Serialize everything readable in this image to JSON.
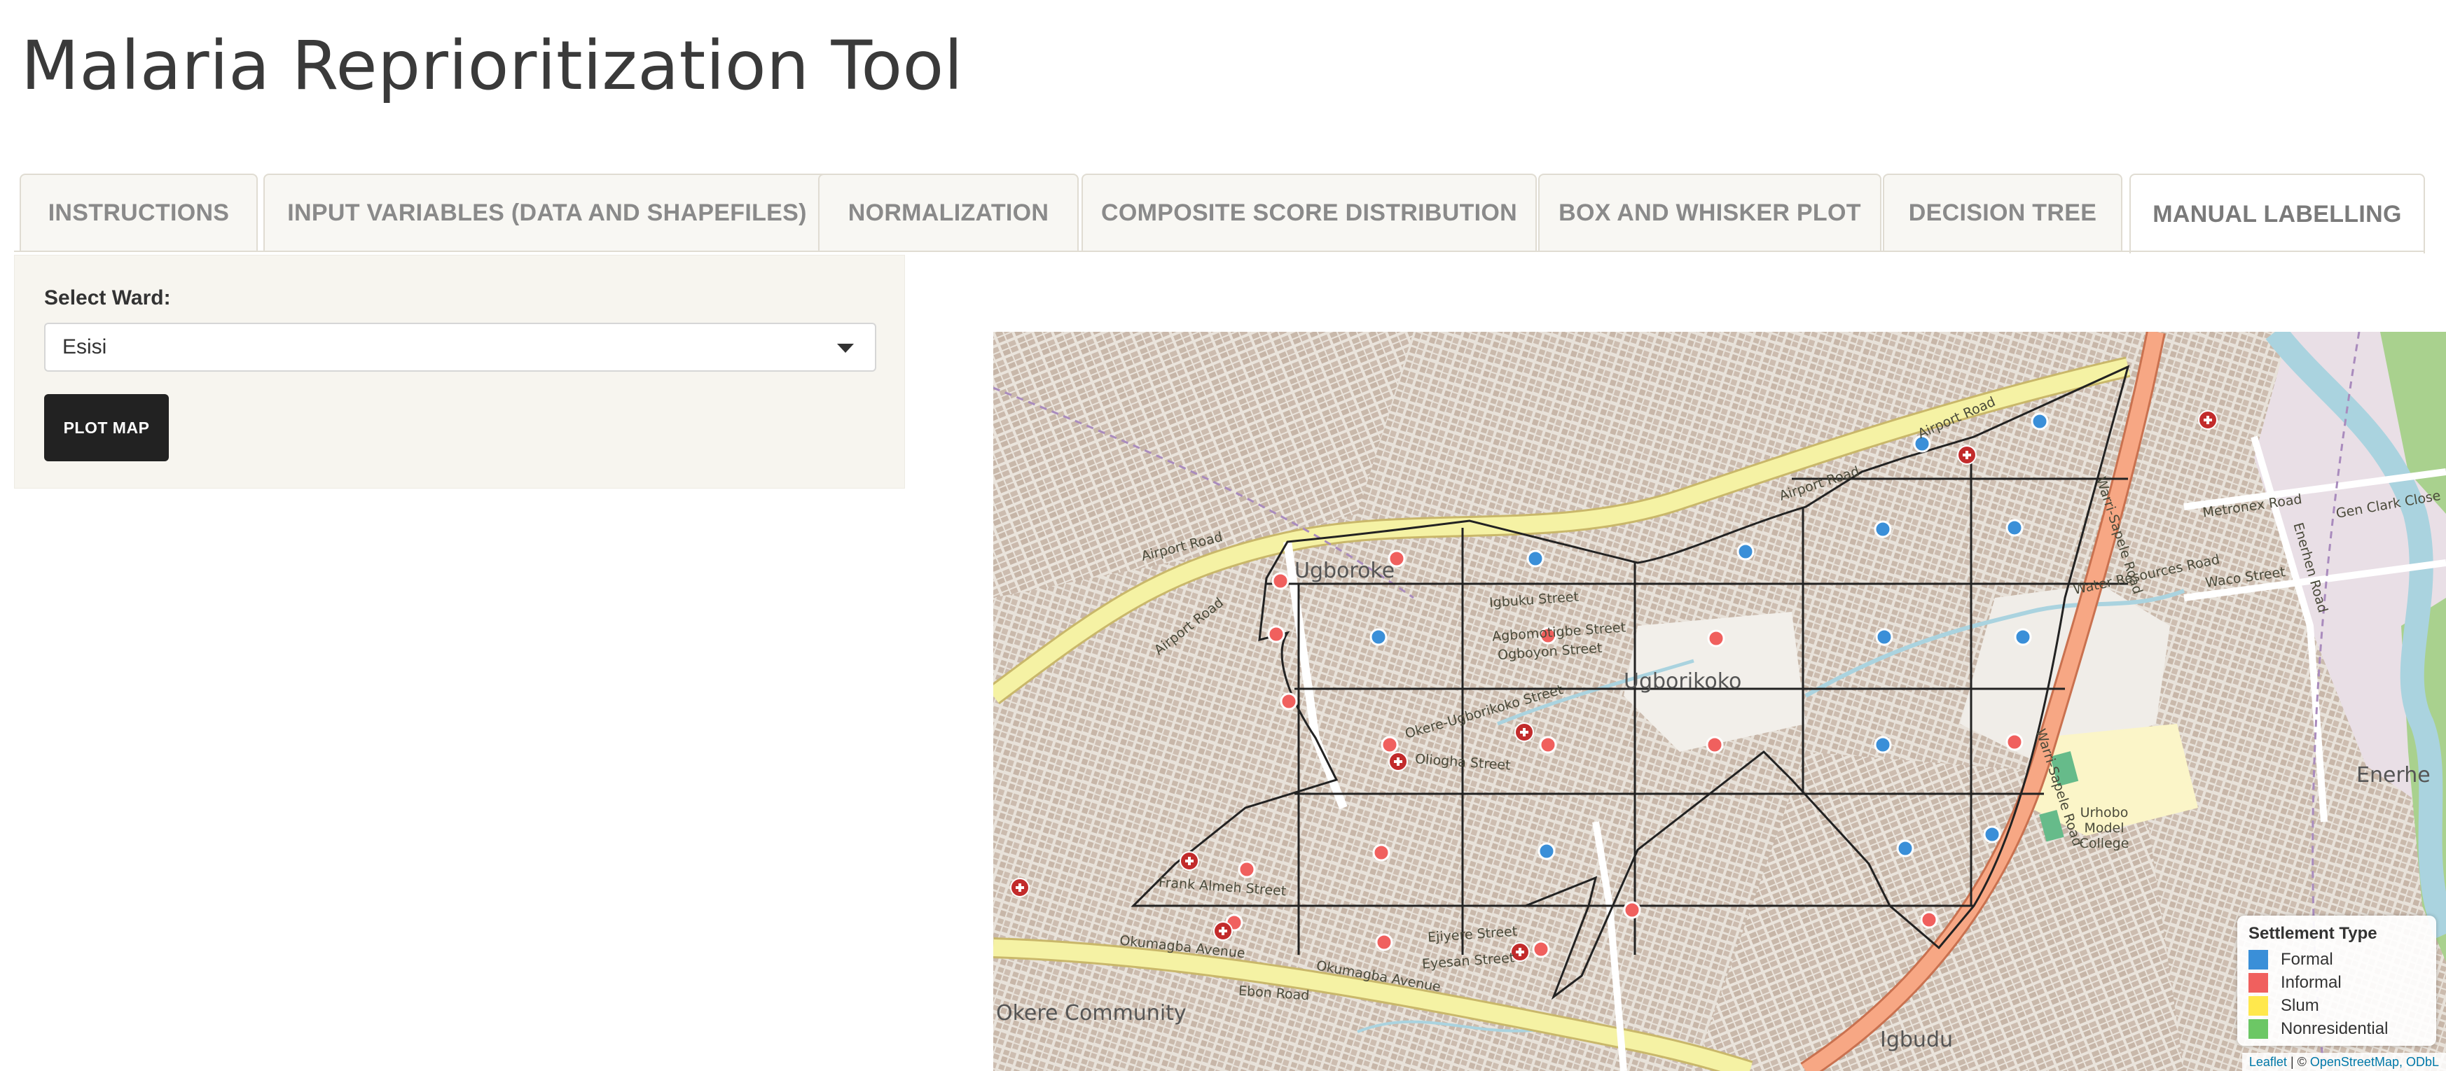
{
  "app": {
    "title": "Malaria Reprioritization Tool"
  },
  "tabs": [
    {
      "label": "INSTRUCTIONS"
    },
    {
      "label": "INPUT VARIABLES (DATA AND SHAPEFILES)"
    },
    {
      "label": "NORMALIZATION"
    },
    {
      "label": "COMPOSITE SCORE DISTRIBUTION"
    },
    {
      "label": "BOX AND WHISKER PLOT"
    },
    {
      "label": "DECISION TREE"
    },
    {
      "label": "MANUAL LABELLING",
      "active": true
    }
  ],
  "sidebar": {
    "ward_label": "Select Ward:",
    "ward_value": "Esisi",
    "plot_button": "PLOT MAP"
  },
  "map": {
    "place_labels": [
      "Ugboroke",
      "Ugborikoko",
      "Enerhe",
      "Okere Community",
      "Igbudu",
      "Urhobo Model College"
    ],
    "road_labels": [
      "Airport Road",
      "Airport Road",
      "Airport Road",
      "Airport Road",
      "Okumagba Avenue",
      "Okumagba Avenue",
      "Warri-Sapele Road",
      "Warri-Sapele Road",
      "Metronex Road",
      "Enerhen Road",
      "Waco Street",
      "Gen Clark Close",
      "Water Resources Road",
      "Igbuku Street",
      "Agbomotigbe Street",
      "Ogboyon Street",
      "Okere-Ugborikoko Street",
      "Oliogha Street",
      "Frank Almeh Street",
      "Eyesan Street",
      "Ejiyere Street",
      "Ebon Road"
    ],
    "legend": {
      "title": "Settlement Type",
      "items": [
        {
          "label": "Formal",
          "color": "#3a8fd8"
        },
        {
          "label": "Informal",
          "color": "#f0605e"
        },
        {
          "label": "Slum",
          "color": "#ffe84d"
        },
        {
          "label": "Nonresidential",
          "color": "#6cc765"
        }
      ]
    },
    "attribution": {
      "leaflet": "Leaflet",
      "sep": " | © ",
      "osm": "OpenStreetMap, ODbL"
    }
  }
}
